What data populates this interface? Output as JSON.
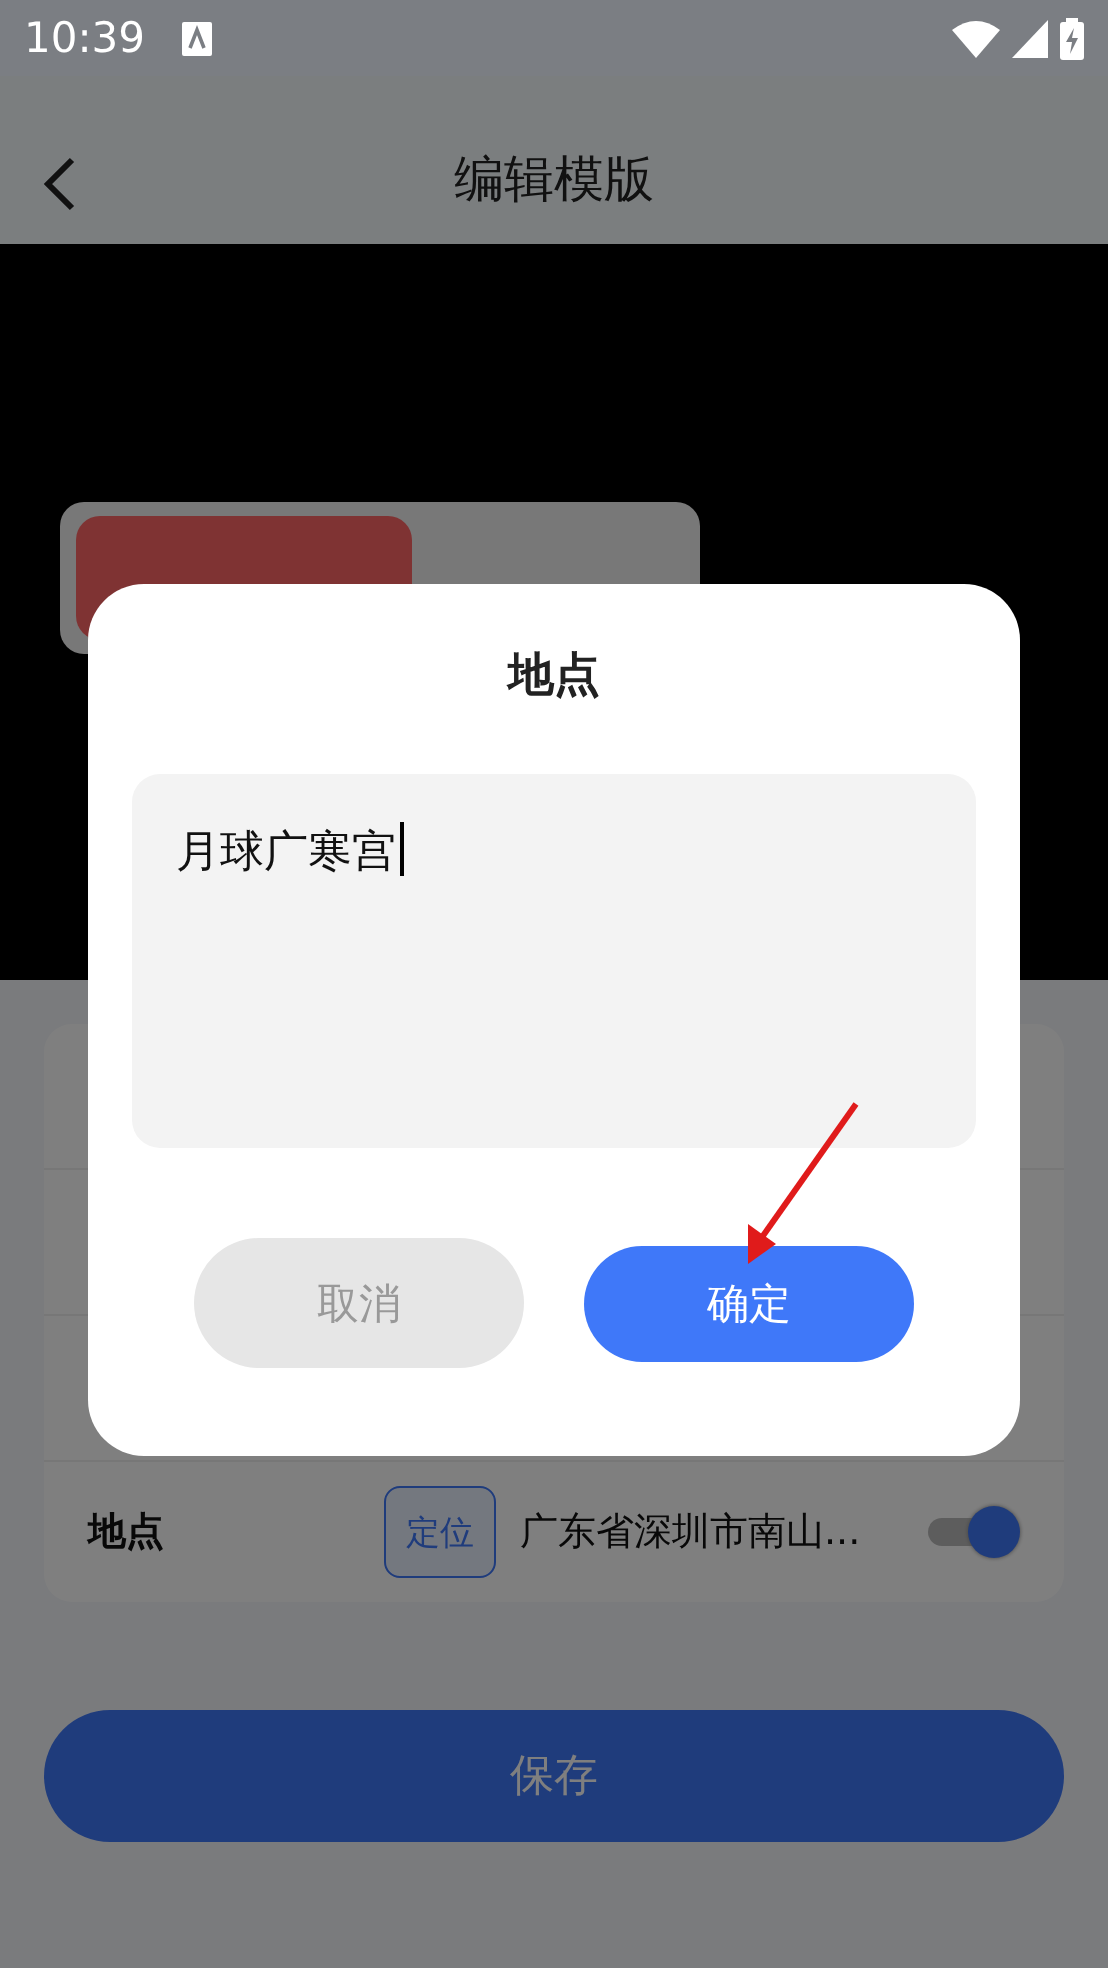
{
  "status_bar": {
    "time": "10:39"
  },
  "header": {
    "title": "编辑模版"
  },
  "settings": {
    "rows": [
      {
        "label": "地点",
        "locate_button": "定位",
        "value": "广东省深圳市南山...",
        "on": true
      }
    ]
  },
  "save_button": "保存",
  "dialog": {
    "title": "地点",
    "input": {
      "value": "月球广寒宫"
    },
    "buttons": [
      {
        "label": "取消",
        "kind": "cancel"
      },
      {
        "label": "确定",
        "kind": "confirm"
      }
    ]
  }
}
